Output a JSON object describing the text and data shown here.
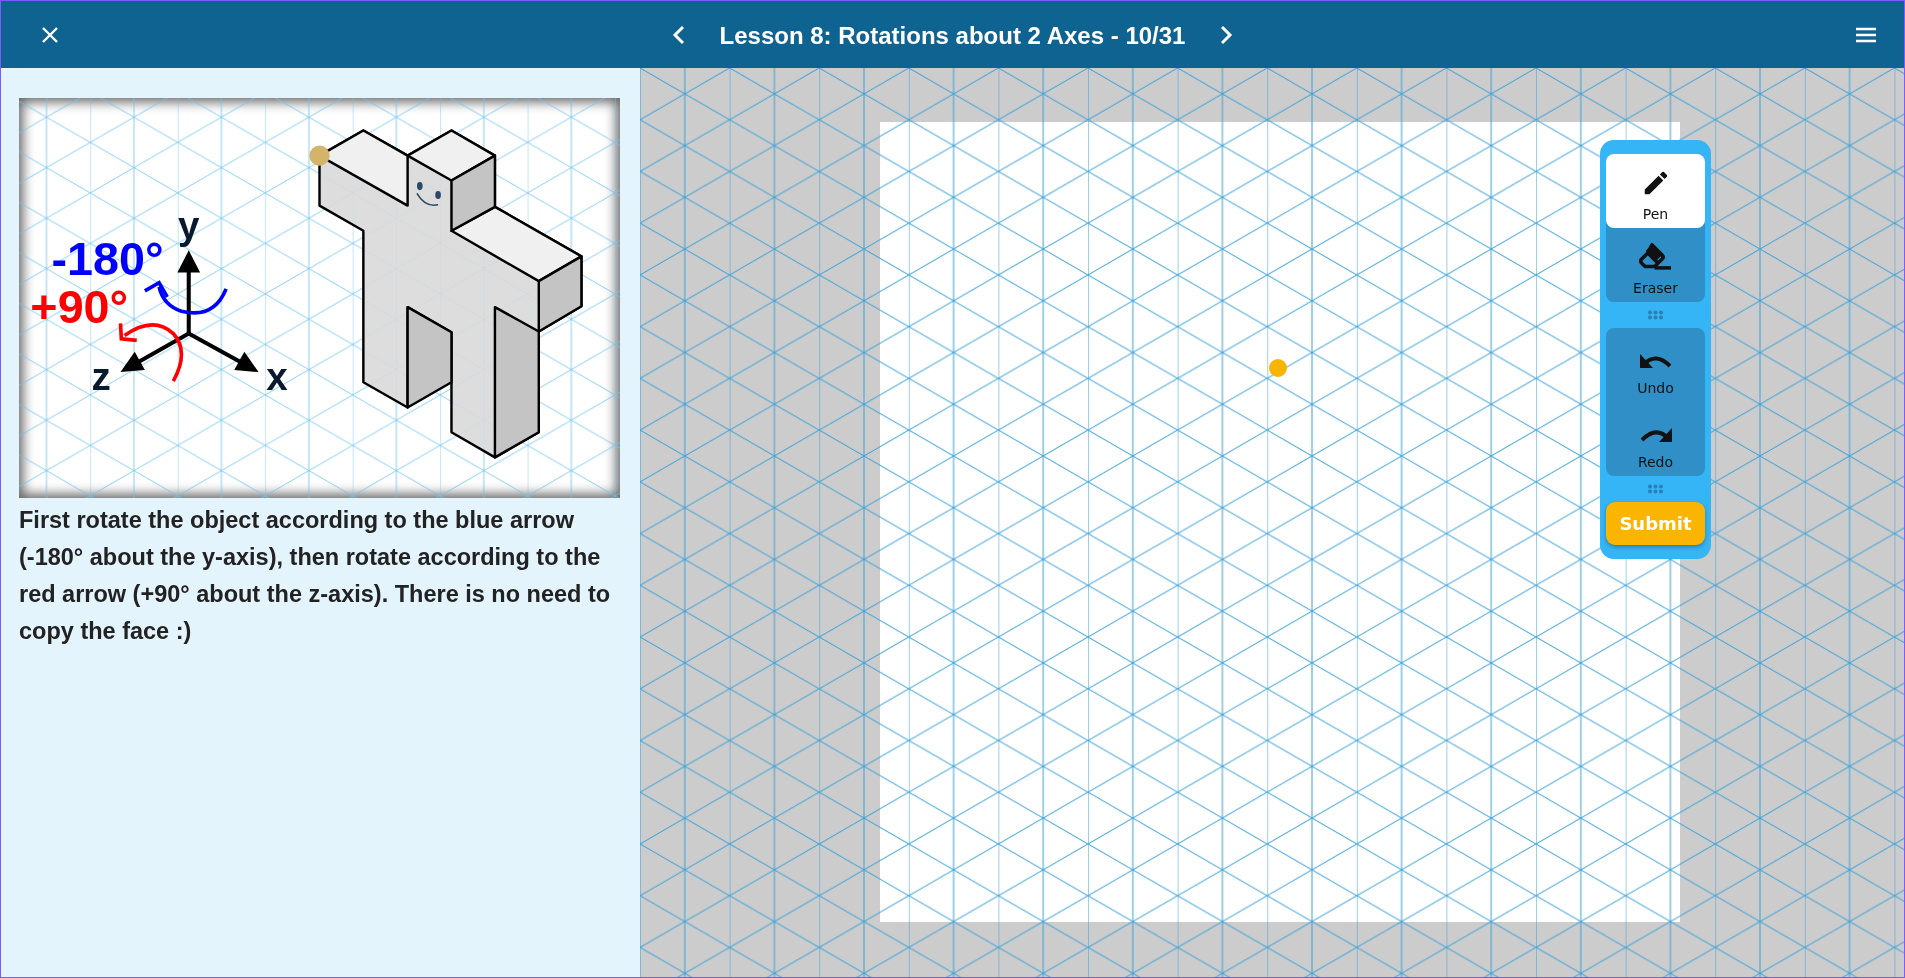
{
  "header": {
    "title": "Lesson 8: Rotations about 2 Axes - 10/31"
  },
  "prompt": {
    "figure": {
      "rotations": [
        {
          "text": "-180°",
          "color": "#0000ff"
        },
        {
          "text": "+90°",
          "color": "#ff0000"
        }
      ],
      "axes": [
        "y",
        "z",
        "x"
      ]
    },
    "text": "First rotate the object according to the blue arrow (-180° about the y-axis), then rotate according to the red arrow (+90° about the z-axis). There is no need to copy the face :)"
  },
  "toolbar": {
    "tools": [
      {
        "label": "Pen",
        "kind": "pen",
        "selected": true
      },
      {
        "label": "Eraser",
        "kind": "eraser",
        "selected": false
      }
    ],
    "history": [
      {
        "label": "Undo",
        "kind": "undo"
      },
      {
        "label": "Redo",
        "kind": "redo"
      }
    ],
    "submit": "Submit"
  }
}
